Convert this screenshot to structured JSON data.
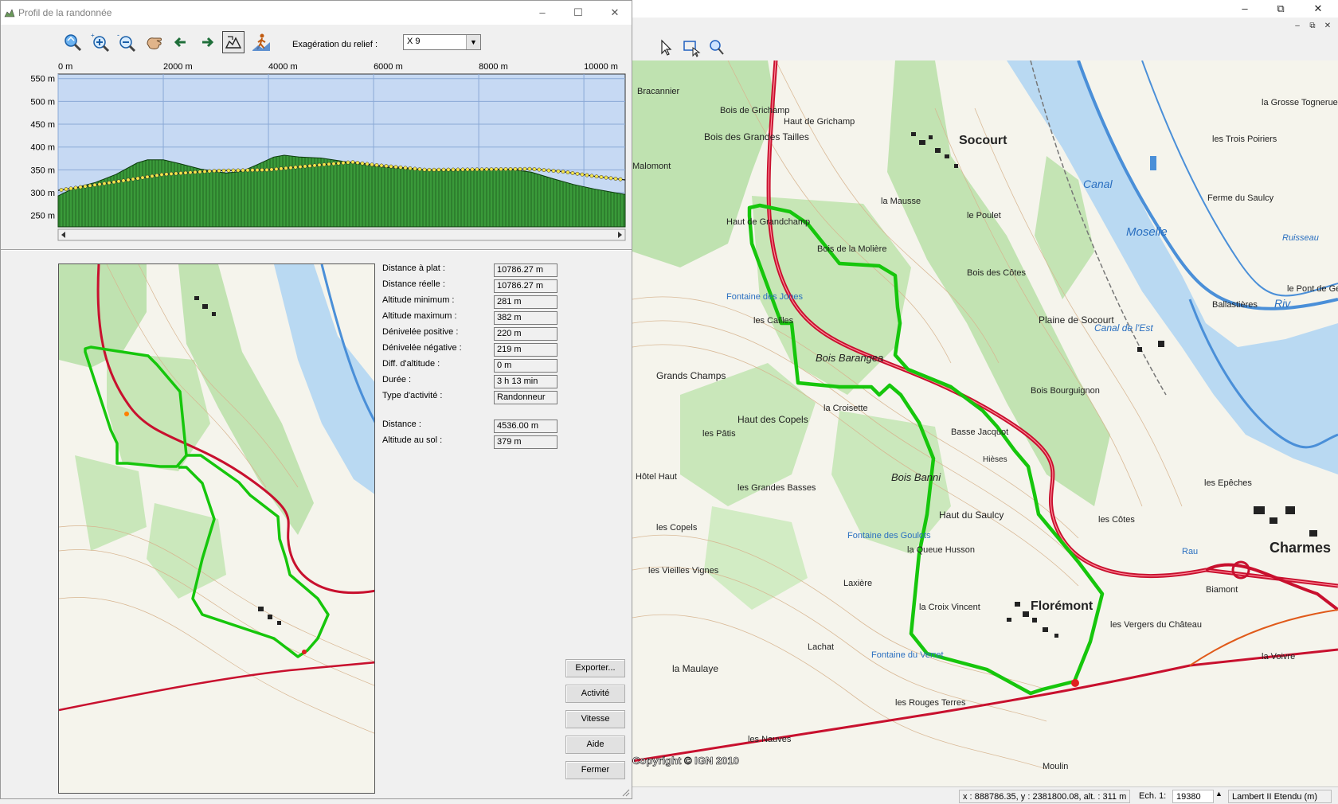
{
  "profile_window": {
    "title": "Profil de la randonnée",
    "exaggeration": {
      "label": "Exagération du relief :",
      "value": "X 9"
    },
    "stats": [
      {
        "label": "Distance à plat :",
        "value": "10786.27 m"
      },
      {
        "label": "Distance réelle :",
        "value": "10786.27 m"
      },
      {
        "label": "Altitude minimum :",
        "value": "281 m"
      },
      {
        "label": "Altitude maximum :",
        "value": "382 m"
      },
      {
        "label": "Dénivelée positive :",
        "value": "220 m"
      },
      {
        "label": "Dénivelée négative :",
        "value": "219 m"
      },
      {
        "label": "Diff. d'altitude :",
        "value": "0 m"
      },
      {
        "label": "Durée :",
        "value": "3 h 13 min"
      },
      {
        "label": "Type d'activité :",
        "value": "Randonneur"
      },
      {
        "label": "Distance :",
        "value": "4536.00 m"
      },
      {
        "label": "Altitude au sol :",
        "value": "379 m"
      }
    ],
    "buttons": {
      "export": "Exporter...",
      "activity": "Activité",
      "speed": "Vitesse",
      "help": "Aide",
      "close": "Fermer"
    },
    "toolbar_icons": [
      "zoom-extent-icon",
      "zoom-in-icon",
      "zoom-out-icon",
      "pan-hand-icon",
      "arrow-left-icon",
      "arrow-right-icon",
      "profile-view-icon",
      "hiker-icon"
    ]
  },
  "chart_data": {
    "type": "area",
    "xlabel": "",
    "ylabel": "",
    "x_ticks": [
      0,
      2000,
      4000,
      6000,
      8000,
      10000
    ],
    "x_tick_labels": [
      "0 m",
      "2000 m",
      "4000 m",
      "6000 m",
      "8000 m",
      "10000 m"
    ],
    "xlim": [
      0,
      10786
    ],
    "y_ticks": [
      250,
      300,
      350,
      400,
      450,
      500,
      550
    ],
    "y_tick_labels": [
      "250 m",
      "300 m",
      "350 m",
      "400 m",
      "450 m",
      "500 m",
      "550 m"
    ],
    "ylim": [
      225,
      560
    ],
    "grid": true,
    "series": [
      {
        "x": [
          0,
          300,
          700,
          1100,
          1500,
          1700,
          2000,
          2300,
          2700,
          3000,
          3200,
          3500,
          3800,
          4100,
          4300,
          4600,
          5000,
          5400,
          5800,
          6000,
          6300,
          6700,
          7100,
          7500,
          7800,
          8200,
          8600,
          9000,
          9400,
          9800,
          10200,
          10786
        ],
        "y": [
          293,
          310,
          322,
          340,
          365,
          372,
          372,
          364,
          352,
          346,
          343,
          347,
          362,
          378,
          382,
          378,
          376,
          369,
          362,
          358,
          355,
          352,
          350,
          349,
          350,
          352,
          351,
          345,
          331,
          318,
          308,
          296
        ]
      },
      {
        "x": [
          0,
          1000,
          2000,
          3000,
          4000,
          5000,
          5600,
          6000,
          7000,
          8000,
          9000,
          9600,
          10200,
          10786
        ],
        "y": [
          305,
          322,
          340,
          348,
          350,
          361,
          367,
          361,
          350,
          351,
          352,
          346,
          336,
          328
        ]
      }
    ]
  },
  "main_window": {
    "status": {
      "coords": "x : 888786.35, y : 2381800.08, alt. : 311 m",
      "scale_label": "Ech. 1:",
      "scale_value": "19380",
      "projection": "Lambert II Etendu (m)"
    },
    "map_copyright": "Copyright © IGN 2010",
    "place_labels": [
      "Socourt",
      "Florémont",
      "Charmes",
      "Bois Barangea",
      "Bois Banni",
      "Haut du Saulcy",
      "Haut des Copels",
      "Grands Champs",
      "les Cailles",
      "la Croisette",
      "les Pâtis",
      "Lachat",
      "la Maulaye",
      "les Nauves",
      "les Rouges Terres",
      "les Vergers du Château",
      "Plaine de Socourt",
      "Canal",
      "Moselle",
      "la Croix Vincent",
      "la Queue Husson",
      "les Vieilles Vignes",
      "les Copels",
      "Bois des Grandes Tailles",
      "Haut de Grichamp",
      "le Poulet",
      "la Mausse",
      "Ferme du Saulcy",
      "les Trois Poiriers",
      "la Grosse Tognerue",
      "Biamont",
      "la Voivre",
      "les Epêches",
      "Ballastières",
      "le Pont de Genêt",
      "les Grandes Basses",
      "Laxière",
      "Bois de la Molière",
      "Bois des Côtes",
      "Bois Bourguignon",
      "Haut de Grandchamp",
      "Bracannier",
      "Malomont",
      "Hôtel Haut",
      "Fontaine des Jones",
      "Fontaine des Goulots",
      "Fontaine du Verret",
      "Moulin",
      "Bois de Grichamp",
      "Basse Jacquot",
      "les Côtes",
      "Hièses",
      "Rau",
      "Riv",
      "Canal de l'Est",
      "Ruisseau"
    ]
  }
}
